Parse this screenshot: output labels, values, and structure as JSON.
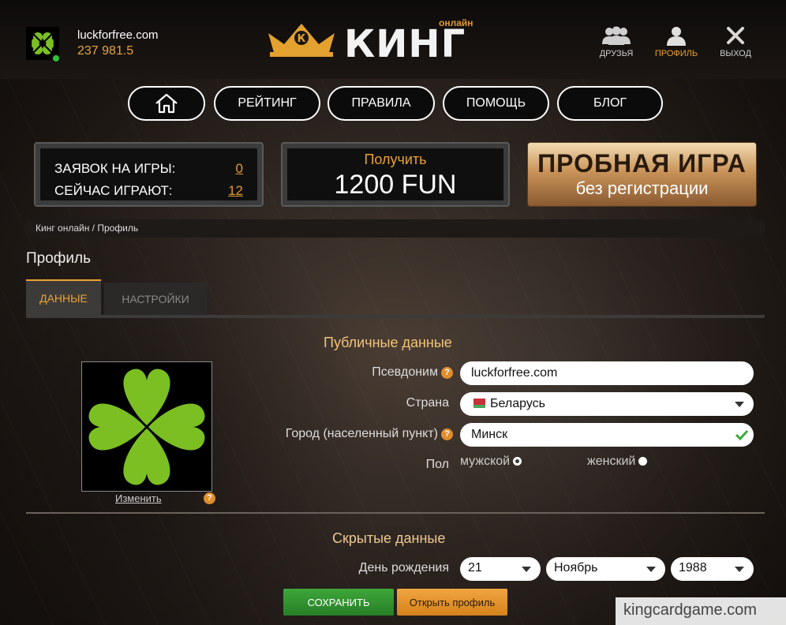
{
  "header": {
    "username": "luckforfree.com",
    "balance": "237 981.5",
    "logo_text": "КИНГ",
    "logo_sub": "онлайн",
    "logo_crown_letter": "К",
    "icons": [
      {
        "name": "friends-icon",
        "label": "ДРУЗЬЯ"
      },
      {
        "name": "profile-icon",
        "label": "ПРОФИЛЬ"
      },
      {
        "name": "logout-icon",
        "label": "ВЫХОД"
      }
    ]
  },
  "nav": {
    "home_icon": "home-icon",
    "items": [
      "РЕЙТИНГ",
      "ПРАВИЛА",
      "ПОМОЩЬ",
      "БЛОГ"
    ]
  },
  "stats": {
    "requests_label": "ЗАЯВОК НА ИГРЫ:",
    "requests_value": "0",
    "playing_label": "СЕЙЧАС ИГРАЮТ:",
    "playing_value": "12"
  },
  "fun": {
    "label": "Получить",
    "amount": "1200 FUN"
  },
  "trial": {
    "title": "ПРОБНАЯ ИГРА",
    "subtitle": "без регистрации"
  },
  "breadcrumbs": "Кинг онлайн / Профиль",
  "page_title": "Профиль",
  "tabs": {
    "data": "ДАННЫЕ",
    "settings": "НАСТРОЙКИ"
  },
  "public": {
    "title": "Публичные данные",
    "nickname_label": "Псевдоним",
    "nickname_value": "luckforfree.com",
    "country_label": "Страна",
    "country_value": "Беларусь",
    "city_label": "Город (населенный пункт)",
    "city_value": "Минск",
    "gender_label": "Пол",
    "gender_male": "мужской",
    "gender_female": "женский",
    "change_avatar": "Изменить",
    "help_mark": "?"
  },
  "hidden": {
    "title": "Скрытые данные",
    "birthday_label": "День рождения",
    "day": "21",
    "month": "Ноябрь",
    "year": "1988"
  },
  "buttons": {
    "save": "СОХРАНИТЬ",
    "open_profile": "Открыть профиль"
  },
  "watermark": "kingcardgame.com",
  "colors": {
    "accent": "#e8a230",
    "save": "#2f9a2f",
    "clover": "#7bbf23"
  }
}
